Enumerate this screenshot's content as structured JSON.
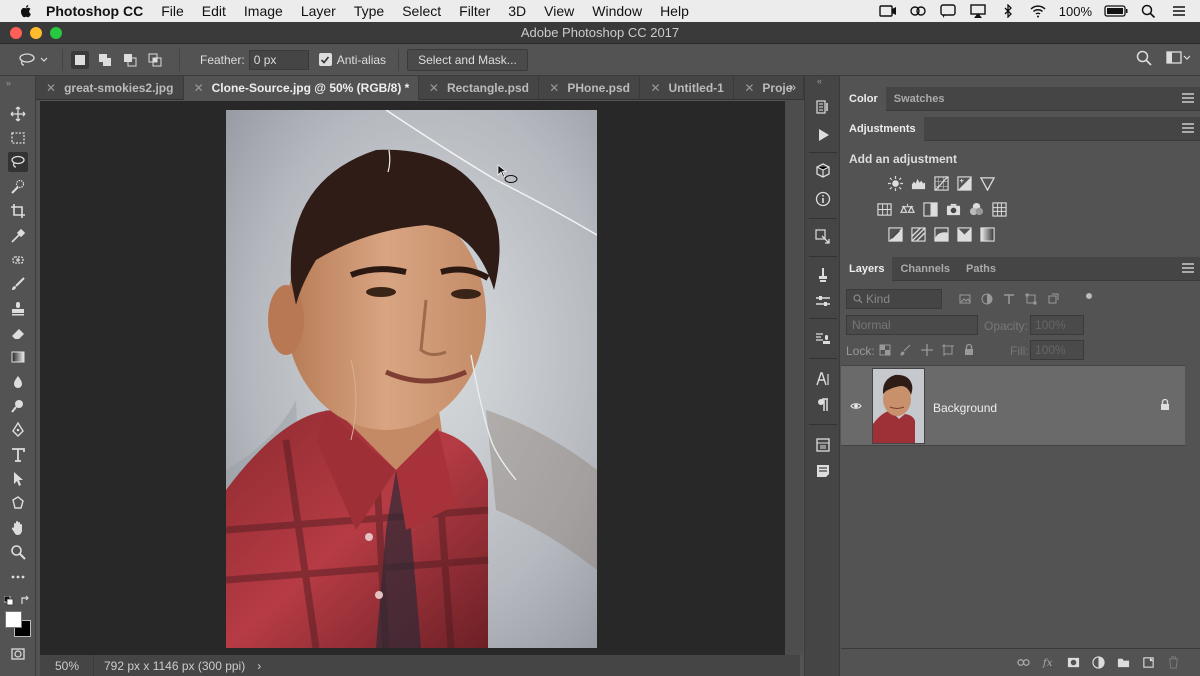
{
  "menubar": {
    "app_name": "Photoshop CC",
    "items": [
      "File",
      "Edit",
      "Image",
      "Layer",
      "Type",
      "Select",
      "Filter",
      "3D",
      "View",
      "Window",
      "Help"
    ],
    "battery": "100%"
  },
  "window": {
    "title": "Adobe Photoshop CC 2017"
  },
  "options_bar": {
    "feather_label": "Feather:",
    "feather_value": "0 px",
    "antialias_label": "Anti-alias",
    "antialias_checked": true,
    "select_mask_label": "Select and Mask..."
  },
  "document_tabs": [
    {
      "label": "great-smokies2.jpg",
      "active": false
    },
    {
      "label": "Clone-Source.jpg @ 50% (RGB/8) *",
      "active": true
    },
    {
      "label": "Rectangle.psd",
      "active": false
    },
    {
      "label": "PHone.psd",
      "active": false
    },
    {
      "label": "Untitled-1",
      "active": false
    },
    {
      "label": "Proje",
      "active": false
    }
  ],
  "tabs_overflow": "»",
  "status_bar": {
    "zoom": "50%",
    "dimensions": "792 px x 1146 px (300 ppi)",
    "arrow": "›"
  },
  "panels": {
    "color_tabs": [
      "Color",
      "Swatches"
    ],
    "adjustments_tab": "Adjustments",
    "adjustments_title": "Add an adjustment",
    "layers_tabs": [
      "Layers",
      "Channels",
      "Paths"
    ],
    "search_placeholder": "Kind",
    "blend_mode": "Normal",
    "opacity_label": "Opacity:",
    "opacity_value": "100%",
    "lock_label": "Lock:",
    "fill_label": "Fill:",
    "fill_value": "100%",
    "layer_name": "Background"
  },
  "colors": {
    "accent_red": "#ff5f57",
    "accent_yellow": "#febc2e",
    "accent_green": "#28c840",
    "panel_bg": "#535353",
    "canvas_bg": "#282828",
    "selected_layer": "#6a6a6a"
  }
}
